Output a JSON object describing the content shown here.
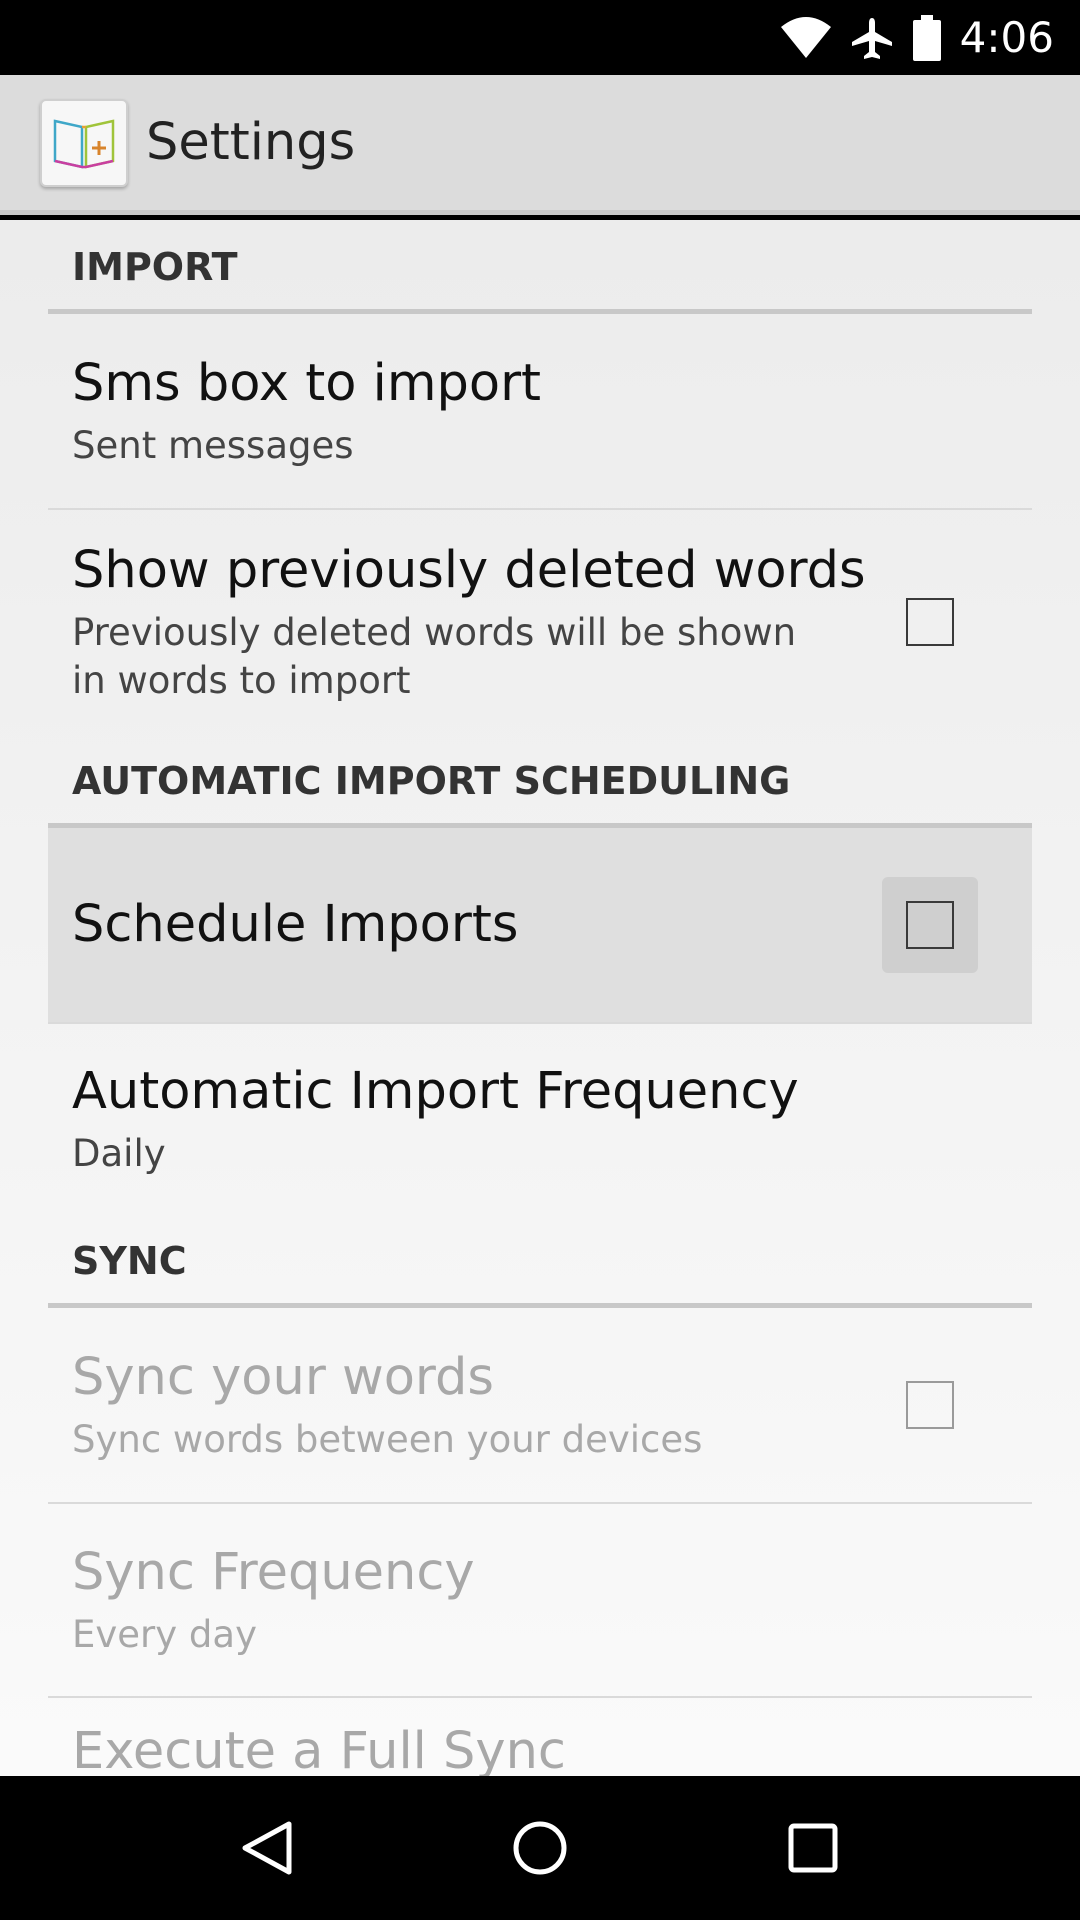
{
  "status_bar": {
    "time": "4:06",
    "icons": [
      "wifi-icon",
      "airplane-mode-icon",
      "battery-icon"
    ]
  },
  "app_bar": {
    "title": "Settings",
    "logo": "book-plus-icon"
  },
  "sections": {
    "import": {
      "title": "IMPORT",
      "sms_box": {
        "title": "Sms box to import",
        "summary": "Sent messages"
      },
      "show_deleted": {
        "title": "Show previously deleted words",
        "summary_line1": "Previously deleted words will be shown",
        "summary_line2": "in words to import",
        "checked": false
      }
    },
    "scheduling": {
      "title": "AUTOMATIC IMPORT SCHEDULING",
      "schedule_imports": {
        "title": "Schedule Imports",
        "checked": false
      },
      "frequency": {
        "title": "Automatic Import Frequency",
        "summary": "Daily"
      }
    },
    "sync": {
      "title": "SYNC",
      "sync_words": {
        "title": "Sync your words",
        "summary": "Sync words between your devices",
        "checked": false,
        "enabled": false
      },
      "sync_frequency": {
        "title": "Sync Frequency",
        "summary": "Every day",
        "enabled": false
      },
      "full_sync": {
        "title": "Execute a Full Sync",
        "enabled": false
      }
    }
  },
  "nav_bar": {
    "buttons": [
      "back-icon",
      "home-icon",
      "recents-icon"
    ]
  },
  "colors": {
    "app_bar": "#dcdcdc",
    "divider": "#c8c8c8",
    "disabled_text": "#a8a8a8",
    "pressed_row": "#dfdfdf"
  }
}
